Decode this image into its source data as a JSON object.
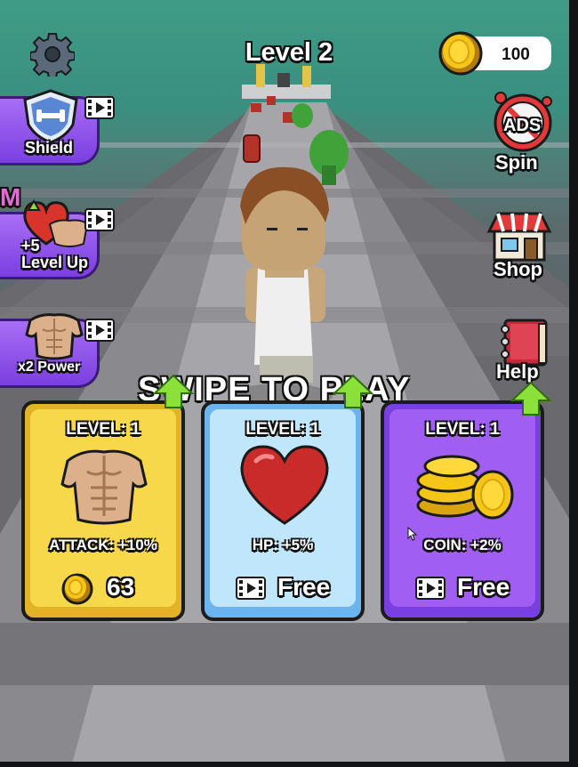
{
  "hud": {
    "level_title": "Level 2",
    "coins": "100",
    "settings_icon": "gear-icon",
    "coin_icon": "gold-coin-icon"
  },
  "left_powerups": [
    {
      "label": "Shield",
      "icon": "shield-icon",
      "ad_icon": "video-ad-icon"
    },
    {
      "label": "+5",
      "label2": "Level Up",
      "icon": "heart-muscle-icon",
      "ad_icon": "video-ad-icon",
      "edge_letter": "M"
    },
    {
      "label": "x2 Power",
      "icon": "muscle-torso-icon",
      "ad_icon": "video-ad-icon"
    }
  ],
  "right_menu": {
    "spin": {
      "label": "Spin",
      "badge": "ADS",
      "icon": "no-ads-spin-icon"
    },
    "shop": {
      "label": "Shop",
      "icon": "shop-icon"
    },
    "help": {
      "label": "Help",
      "icon": "book-icon"
    }
  },
  "prompt": "SWIPE TO PLAY",
  "upgrade_cards": [
    {
      "level": "LEVEL: 1",
      "stat": "ATTACK: +10%",
      "cost": "63",
      "cost_icon": "gold-coin-icon",
      "icon": "muscle-torso-icon",
      "color": "#f7d84a",
      "border": "#e2b326"
    },
    {
      "level": "LEVEL: 1",
      "stat": "HP: +5%",
      "cost": "Free",
      "cost_icon": "video-ad-icon",
      "icon": "heart-icon",
      "color": "#bfe6fb",
      "border": "#6cb4ee"
    },
    {
      "level": "LEVEL: 1",
      "stat": "COIN: +2%",
      "cost": "Free",
      "cost_icon": "video-ad-icon",
      "icon": "coin-stack-icon",
      "color": "#a05ef2",
      "border": "#7a3fe0"
    }
  ],
  "colors": {
    "purple": "#8a4fe8",
    "yellow": "#f7d84a",
    "blue": "#bfe6fb",
    "arrow_green": "#8be03a"
  }
}
